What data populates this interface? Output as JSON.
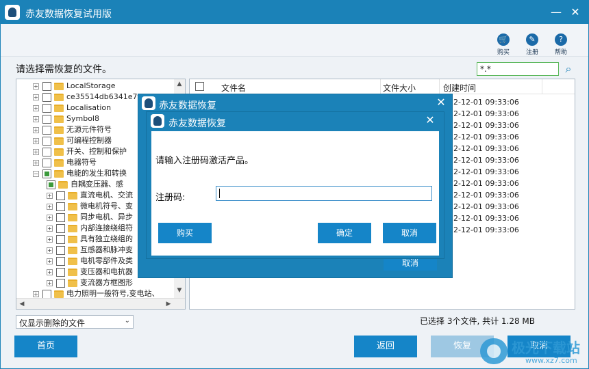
{
  "app": {
    "title": "赤友数据恢复试用版",
    "minimize_glyph": "—",
    "close_glyph": "✕"
  },
  "toolbar": {
    "buy_label": "购买",
    "register_label": "注册",
    "help_label": "帮助"
  },
  "main": {
    "prompt": "请选择需恢复的文件。",
    "filter_value": "*.*"
  },
  "tree": {
    "items": [
      {
        "label": "LocalStorage",
        "level": 1
      },
      {
        "label": "ce35514db6341e7f3",
        "level": 1
      },
      {
        "label": "Localisation",
        "level": 1
      },
      {
        "label": "Symbol8",
        "level": 1
      },
      {
        "label": "无源元件符号",
        "level": 1
      },
      {
        "label": "可编程控制器",
        "level": 1
      },
      {
        "label": "开关、控制和保护",
        "level": 1
      },
      {
        "label": "电器符号",
        "level": 1
      },
      {
        "label": "电能的发生和转换",
        "level": 1,
        "expanded": true,
        "partial": true
      },
      {
        "label": "自耦变压器、感",
        "level": 2,
        "partial": true
      },
      {
        "label": "直流电机、交流",
        "level": 2
      },
      {
        "label": "微电机符号、变",
        "level": 2
      },
      {
        "label": "同步电机、异步",
        "level": 2
      },
      {
        "label": "内部连接绕组符",
        "level": 2
      },
      {
        "label": "具有独立绕组的",
        "level": 2
      },
      {
        "label": "互感器和脉冲变",
        "level": 2
      },
      {
        "label": "电机零部件及类",
        "level": 2
      },
      {
        "label": "变压器和电抗器",
        "level": 2
      },
      {
        "label": "变流器方框图形",
        "level": 2
      },
      {
        "label": "电力照明一般符号,变电站、",
        "level": 1
      }
    ]
  },
  "list": {
    "col_name": "文件名",
    "col_size": "文件大小",
    "col_time": "创建时间",
    "times": [
      "22-12-01 09:33:06",
      "22-12-01 09:33:06",
      "22-12-01 09:33:06",
      "22-12-01 09:33:06",
      "22-12-01 09:33:06",
      "22-12-01 09:33:06",
      "22-12-01 09:33:06",
      "22-12-01 09:33:06",
      "22-12-01 09:33:06",
      "22-12-01 09:33:06",
      "22-12-01 09:33:06",
      "22-12-01 09:33:06"
    ]
  },
  "bottom": {
    "mode_option": "仅显示删除的文件",
    "status": "已选择 3个文件, 共计 1.28 MB",
    "home_label": "首页",
    "back_label": "返回",
    "recover_label": "恢复",
    "cancel_label": "取消"
  },
  "watermark": {
    "text": "极光下载站",
    "url": "www.xz7.com"
  },
  "dialog_outer": {
    "title": "赤友数据恢复",
    "hidden_button": "取消"
  },
  "dialog_inner": {
    "title": "赤友数据恢复",
    "message": "请输入注册码激活产品。",
    "code_label": "注册码:",
    "code_value": "",
    "buy_label": "购买",
    "ok_label": "确定",
    "cancel_label": "取消"
  }
}
